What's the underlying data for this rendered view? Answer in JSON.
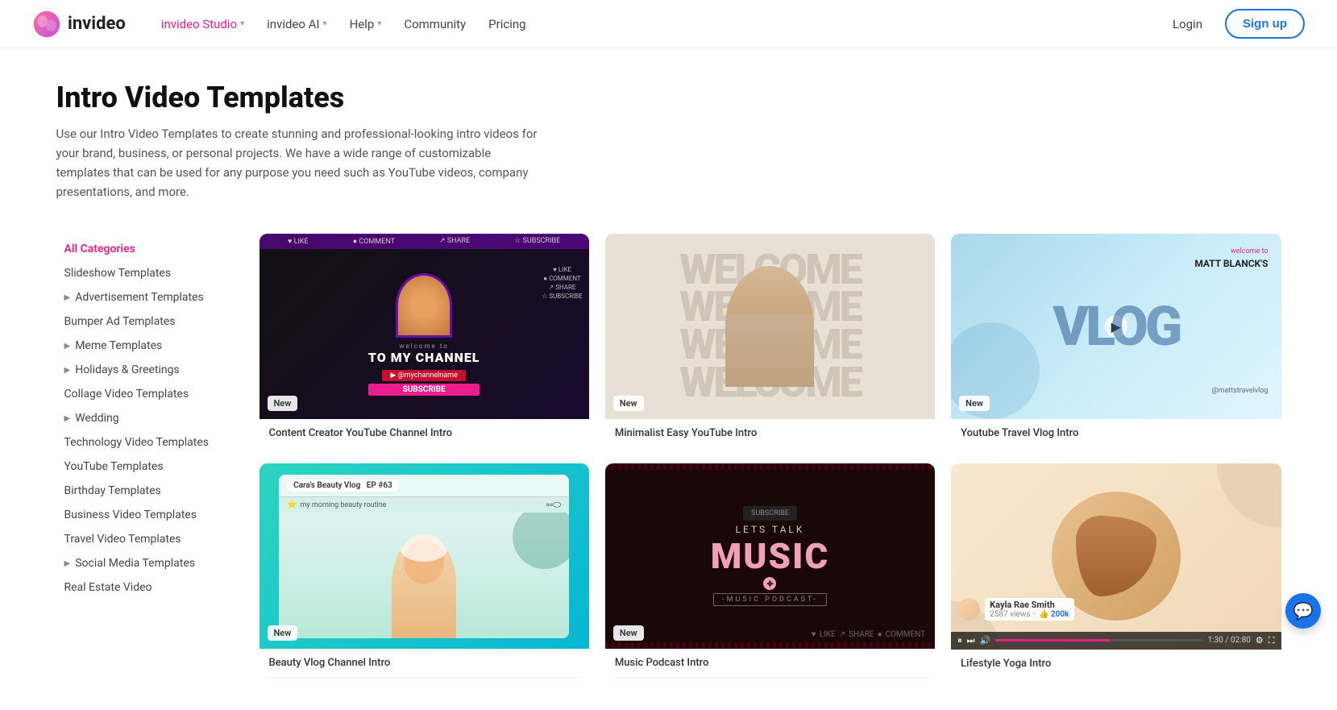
{
  "nav": {
    "logo_text": "invideo",
    "studio_label": "invideo Studio",
    "ai_label": "invideo AI",
    "help_label": "Help",
    "community_label": "Community",
    "pricing_label": "Pricing",
    "login_label": "Login",
    "signup_label": "Sign up"
  },
  "page": {
    "title": "Intro Video Templates",
    "description": "Use our Intro Video Templates to create stunning and professional-looking intro videos for your brand, business, or personal projects. We have a wide range of customizable templates that can be used for any purpose you need such as YouTube videos, company presentations, and more."
  },
  "sidebar": {
    "items": [
      {
        "id": "all-categories",
        "label": "All Categories",
        "active": true,
        "hasArrow": false
      },
      {
        "id": "slideshow",
        "label": "Slideshow Templates",
        "active": false,
        "hasArrow": false
      },
      {
        "id": "advertisement",
        "label": "Advertisement Templates",
        "active": false,
        "hasArrow": true
      },
      {
        "id": "bumper-ad",
        "label": "Bumper Ad Templates",
        "active": false,
        "hasArrow": false
      },
      {
        "id": "meme",
        "label": "Meme Templates",
        "active": false,
        "hasArrow": true
      },
      {
        "id": "holidays",
        "label": "Holidays & Greetings",
        "active": false,
        "hasArrow": true
      },
      {
        "id": "collage",
        "label": "Collage Video Templates",
        "active": false,
        "hasArrow": false
      },
      {
        "id": "wedding",
        "label": "Wedding",
        "active": false,
        "hasArrow": true
      },
      {
        "id": "technology",
        "label": "Technology Video Templates",
        "active": false,
        "hasArrow": false
      },
      {
        "id": "youtube",
        "label": "YouTube Templates",
        "active": false,
        "hasArrow": false
      },
      {
        "id": "birthday",
        "label": "Birthday Templates",
        "active": false,
        "hasArrow": false
      },
      {
        "id": "business",
        "label": "Business Video Templates",
        "active": false,
        "hasArrow": false
      },
      {
        "id": "travel",
        "label": "Travel Video Templates",
        "active": false,
        "hasArrow": false
      },
      {
        "id": "social-media",
        "label": "Social Media Templates",
        "active": false,
        "hasArrow": true
      },
      {
        "id": "real-estate",
        "label": "Real Estate Video",
        "active": false,
        "hasArrow": false
      }
    ]
  },
  "templates": [
    {
      "id": "t1",
      "name": "Content Creator YouTube Channel Intro",
      "badge": "New",
      "type": "gaming-intro"
    },
    {
      "id": "t2",
      "name": "Minimalist Easy YouTube Intro",
      "badge": "New",
      "type": "minimalist"
    },
    {
      "id": "t3",
      "name": "Youtube Travel Vlog Intro",
      "badge": "New",
      "type": "vlog"
    },
    {
      "id": "t4",
      "name": "Beauty Vlog Channel Intro",
      "badge": "New",
      "type": "beauty"
    },
    {
      "id": "t5",
      "name": "Music Podcast Intro",
      "badge": "New",
      "type": "music"
    },
    {
      "id": "t6",
      "name": "Lifestyle Yoga Intro",
      "badge": "",
      "type": "yoga",
      "commenter_name": "Kayla Rae Smith",
      "commenter_views": "2587 views",
      "commenter_likes": "200k",
      "video_time": "1:30 / 02:80"
    }
  ],
  "chat": {
    "icon": "💬"
  }
}
